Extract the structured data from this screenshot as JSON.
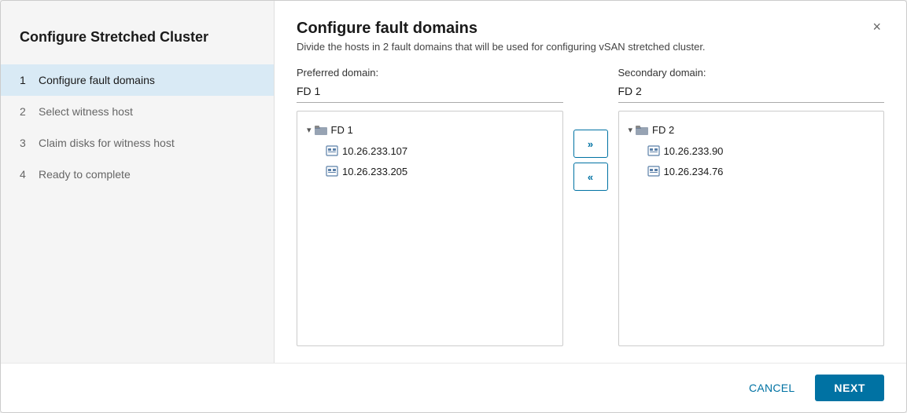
{
  "dialog": {
    "sidebar_title": "Configure Stretched Cluster",
    "close_label": "×",
    "steps": [
      {
        "num": "1",
        "label": "Configure fault domains",
        "active": true
      },
      {
        "num": "2",
        "label": "Select witness host",
        "active": false
      },
      {
        "num": "3",
        "label": "Claim disks for witness host",
        "active": false
      },
      {
        "num": "4",
        "label": "Ready to complete",
        "active": false
      }
    ],
    "main_title": "Configure fault domains",
    "main_subtitle": "Divide the hosts in 2 fault domains that will be used for configuring vSAN stretched cluster.",
    "preferred_domain": {
      "label": "Preferred domain:",
      "value": "FD 1",
      "folder_label": "FD 1",
      "hosts": [
        "10.26.233.107",
        "10.26.233.205"
      ]
    },
    "secondary_domain": {
      "label": "Secondary domain:",
      "value": "FD 2",
      "folder_label": "FD 2",
      "hosts": [
        "10.26.233.90",
        "10.26.234.76"
      ]
    },
    "btn_forward": "»",
    "btn_backward": "«",
    "btn_cancel": "CANCEL",
    "btn_next": "NEXT"
  }
}
